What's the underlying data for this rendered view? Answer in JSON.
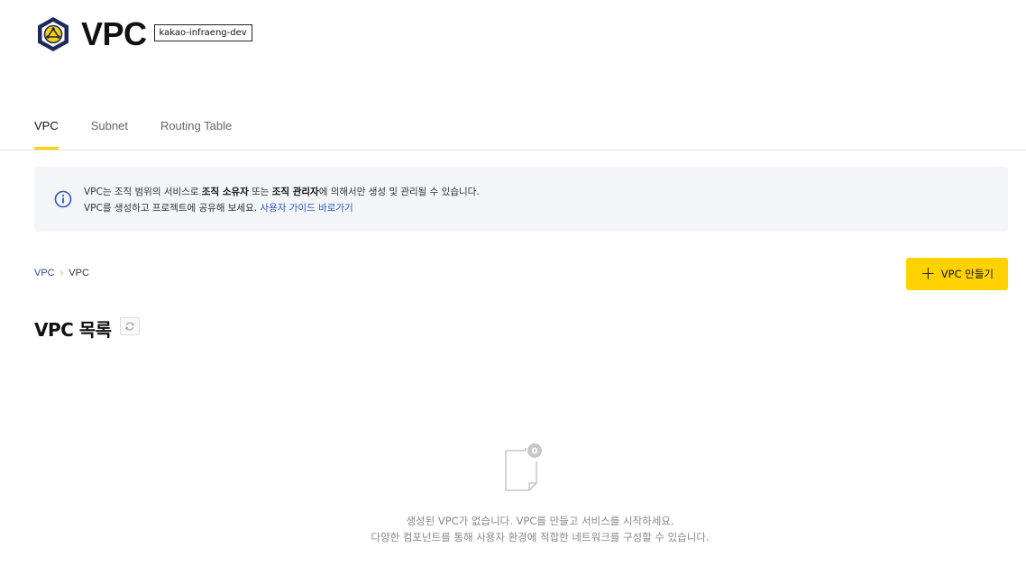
{
  "header": {
    "title": "VPC",
    "project_badge": "kakao-infraeng-dev"
  },
  "tabs": [
    {
      "label": "VPC",
      "active": true
    },
    {
      "label": "Subnet",
      "active": false
    },
    {
      "label": "Routing Table",
      "active": false
    }
  ],
  "info": {
    "line1_pre": "VPC는 조직 범위의 서비스로 ",
    "line1_bold1": "조직 소유자",
    "line1_mid": " 또는 ",
    "line1_bold2": "조직 관리자",
    "line1_post": "에 의해서만 생성 및 관리될 수 있습니다.",
    "line2_pre": "VPC를 생성하고 프로젝트에 공유해 보세요. ",
    "line2_link": "사용자 가이드 바로가기"
  },
  "breadcrumb": {
    "root": "VPC",
    "separator": "›",
    "current": "VPC"
  },
  "create_button": {
    "icon": "plus-icon",
    "label": "VPC 만들기"
  },
  "list": {
    "title": "VPC 목록"
  },
  "empty_state": {
    "count_badge": "0",
    "line1": "생성된 VPC가 없습니다. VPC를 만들고 서비스를 시작하세요.",
    "line2": "다양한 컴포넌트를 통해 사용자 환경에 적합한 네트워크를 구성할 수 있습니다."
  },
  "colors": {
    "accent": "#ffd200",
    "link": "#2f56b8",
    "info_bg": "#f3f5f9"
  }
}
